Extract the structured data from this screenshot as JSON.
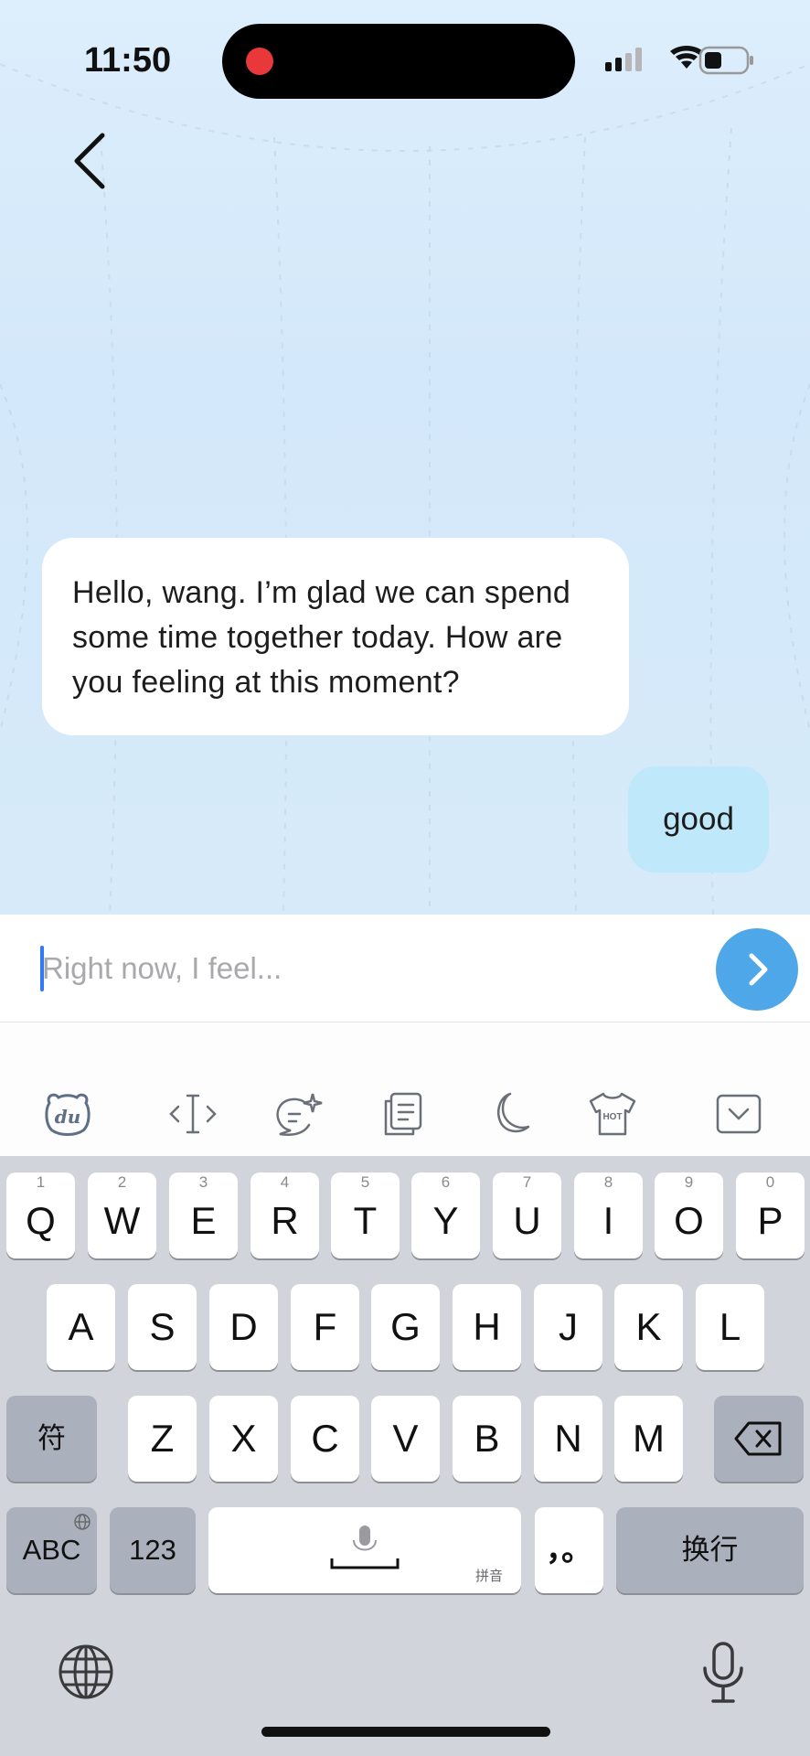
{
  "status_bar": {
    "time": "11:50"
  },
  "chat": {
    "back_icon": "chevron-left-icon",
    "messages": [
      {
        "role": "assistant",
        "text": "Hello, wang. I’m glad we can spend some time together today. How are you feeling at this moment?"
      },
      {
        "role": "user",
        "text": "good"
      }
    ]
  },
  "composer": {
    "placeholder": "Right now, I feel...",
    "value": "",
    "send_icon": "chevron-right-icon",
    "send_color": "#4ea7e9"
  },
  "keyboard_toolbar": {
    "icons": [
      "du-bear-icon",
      "cursor-move-icon",
      "ai-chat-icon",
      "clipboard-icon",
      "moon-icon",
      "hot-shirt-icon",
      "hide-keyboard-icon"
    ],
    "hot_label": "HOT",
    "du_label": "du"
  },
  "keyboard": {
    "row1": [
      {
        "key": "Q",
        "hint": "1"
      },
      {
        "key": "W",
        "hint": "2"
      },
      {
        "key": "E",
        "hint": "3"
      },
      {
        "key": "R",
        "hint": "4"
      },
      {
        "key": "T",
        "hint": "5"
      },
      {
        "key": "Y",
        "hint": "6"
      },
      {
        "key": "U",
        "hint": "7"
      },
      {
        "key": "I",
        "hint": "8"
      },
      {
        "key": "O",
        "hint": "9"
      },
      {
        "key": "P",
        "hint": "0"
      }
    ],
    "row2": [
      "A",
      "S",
      "D",
      "F",
      "G",
      "H",
      "J",
      "K",
      "L"
    ],
    "row3": [
      "Z",
      "X",
      "C",
      "V",
      "B",
      "N",
      "M"
    ],
    "symbol_key": "符",
    "abc_key": "ABC",
    "num_key": "123",
    "space_sub": "拼音",
    "punct_key": "，。",
    "return_key": "换行",
    "globe_icon": "globe-icon",
    "mic_icon": "microphone-icon"
  }
}
